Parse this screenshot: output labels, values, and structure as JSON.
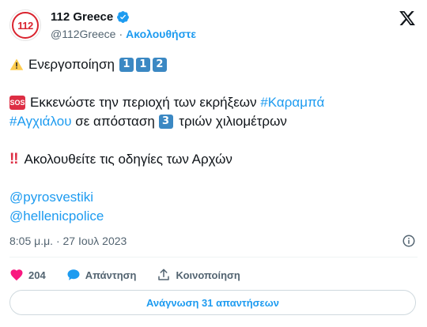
{
  "account": {
    "display_name": "112 Greece",
    "handle": "@112Greece",
    "separator": "·",
    "follow_label": "Ακολουθήστε",
    "avatar_text": "112"
  },
  "tweet": {
    "line1_text": "Ενεργοποίηση",
    "line1_keycaps": [
      "1",
      "1",
      "2"
    ],
    "sos_label": "SOS",
    "line2_text": "Εκκενώστε την περιοχή των εκρήξεων ",
    "line2_hashtag": "#Καραμπά",
    "line3_hashtag": "#Αγχιάλου",
    "line3_text_a": " σε απόσταση ",
    "line3_keycap": "3",
    "line3_text_b": " τριών χιλιομέτρων",
    "line4_text": "Ακολουθείτε τις οδηγίες των Αρχών",
    "mention1": "@pyrosvestiki",
    "mention2": "@hellenicpolice",
    "timestamp": "8:05 μ.μ. · 27 Ιουλ 2023"
  },
  "actions": {
    "like_count": "204",
    "reply_label": "Απάντηση",
    "share_label": "Κοινοποίηση"
  },
  "read_replies_label": "Ανάγνωση 31 απαντήσεων",
  "colors": {
    "accent": "#1d9bf0",
    "like": "#f91880",
    "muted": "#536471",
    "keycap": "#3b88c3"
  },
  "icons": [
    "verified-badge-icon",
    "x-logo-icon",
    "warning-icon",
    "sos-icon",
    "double-exclamation-icon",
    "info-icon",
    "heart-icon",
    "reply-bubble-icon",
    "share-icon"
  ]
}
